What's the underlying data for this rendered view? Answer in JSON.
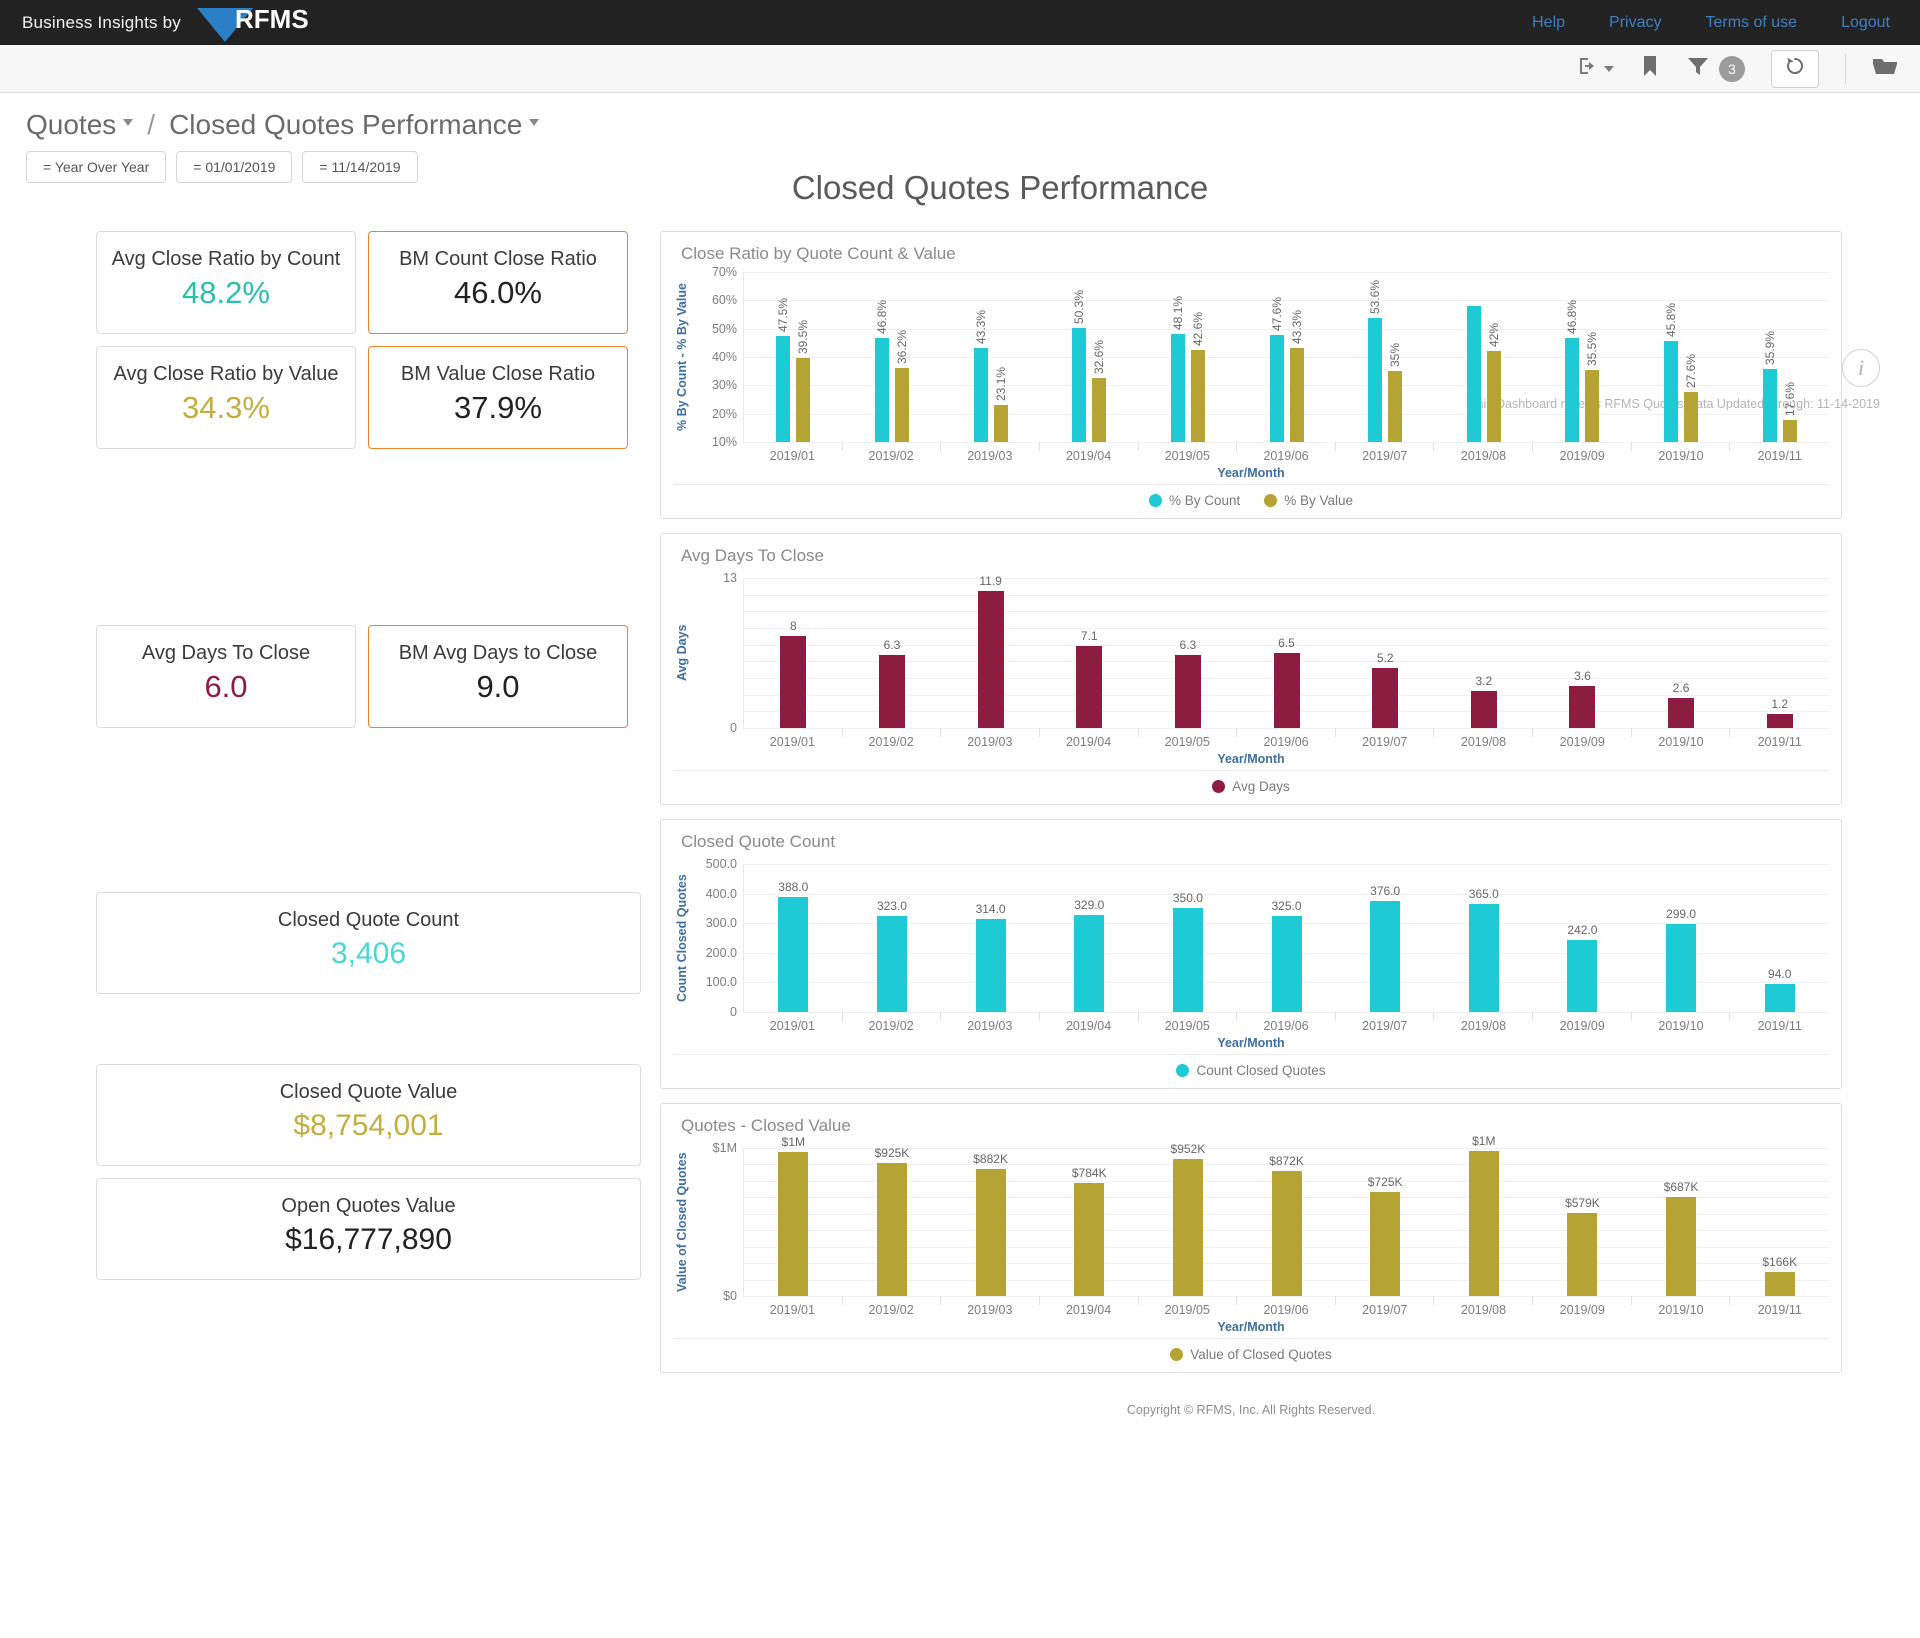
{
  "header": {
    "brand_text": "Business Insights by",
    "brand_logo": "RFMS",
    "nav": [
      {
        "label": "Help"
      },
      {
        "label": "Privacy"
      },
      {
        "label": "Terms of use"
      },
      {
        "label": "Logout"
      }
    ]
  },
  "toolbar": {
    "export_icon": "export-icon",
    "bookmark_icon": "bookmark-icon",
    "filter_icon": "filter-icon",
    "filter_badge": "3",
    "refresh_icon": "refresh-icon",
    "folder_icon": "folder-icon"
  },
  "breadcrumb": {
    "root": "Quotes",
    "separator": "/",
    "current": "Closed Quotes Performance",
    "chips": [
      {
        "label": "= Year Over Year"
      },
      {
        "label": "= 01/01/2019"
      },
      {
        "label": "= 11/14/2019"
      }
    ]
  },
  "page": {
    "title": "Closed Quotes Performance",
    "info_icon": "info-icon",
    "info_note": "This Dashboard reflects RFMS Quotes Data Updated through:  11-14-2019",
    "copyright": "Copyright © RFMS, Inc.  All Rights Reserved."
  },
  "kpis": [
    {
      "label": "Avg Close Ratio by Count",
      "value": "48.2%",
      "color_class": "v-teal",
      "benchmark": false
    },
    {
      "label": "BM Count Close Ratio",
      "value": "46.0%",
      "color_class": "v-dark",
      "benchmark": true
    },
    {
      "label": "Avg Close Ratio by Value",
      "value": "34.3%",
      "color_class": "v-gold",
      "benchmark": false
    },
    {
      "label": "BM Value Close Ratio",
      "value": "37.9%",
      "color_class": "v-dark",
      "benchmark": true
    },
    {
      "label": "Avg Days To Close",
      "value": "6.0",
      "color_class": "v-maroon",
      "benchmark": false
    },
    {
      "label": "BM Avg Days to Close",
      "value": "9.0",
      "color_class": "v-dark",
      "benchmark": true
    },
    {
      "label": "Closed Quote Count",
      "value": "3,406",
      "color_class": "v-cyan",
      "benchmark": false
    },
    {
      "label": "Closed Quote Value",
      "value": "$8,754,001",
      "color_class": "v-gold",
      "benchmark": false
    },
    {
      "label": "Open Quotes Value",
      "value": "$16,777,890",
      "color_class": "v-dark",
      "benchmark": false
    }
  ],
  "colors": {
    "cyan": "#1ecbd4",
    "gold": "#b5a333",
    "maroon": "#8c1d40",
    "accent_orange": "#f0802a",
    "axis_blue": "#3e6f9e"
  },
  "chart_data": [
    {
      "type": "bar",
      "title": "Close Ratio by Quote Count & Value",
      "xlabel": "Year/Month",
      "ylabel": "% By Count - % By Value",
      "categories": [
        "2019/01",
        "2019/02",
        "2019/03",
        "2019/04",
        "2019/05",
        "2019/06",
        "2019/07",
        "2019/08",
        "2019/09",
        "2019/10",
        "2019/11"
      ],
      "yticks": [
        "70%",
        "60%",
        "50%",
        "40%",
        "30%",
        "20%",
        "10%"
      ],
      "ylim": [
        10,
        70
      ],
      "grid": true,
      "legend_position": "bottom",
      "series": [
        {
          "name": "% By Count",
          "color": "#1ecbd4",
          "values": [
            47.5,
            46.8,
            43.3,
            50.3,
            48.1,
            47.6,
            53.6,
            58.0,
            46.8,
            45.8,
            35.9
          ],
          "labels": [
            "47.5%",
            "46.8%",
            "43.3%",
            "50.3%",
            "48.1%",
            "47.6%",
            "53.6%",
            "",
            "46.8%",
            "45.8%",
            "35.9%"
          ]
        },
        {
          "name": "% By Value",
          "color": "#b5a333",
          "values": [
            39.5,
            36.2,
            23.1,
            32.6,
            42.6,
            43.3,
            35.0,
            42.0,
            35.5,
            27.6,
            17.6
          ],
          "labels": [
            "39.5%",
            "36.2%",
            "23.1%",
            "32.6%",
            "42.6%",
            "43.3%",
            "35%",
            "42%",
            "35.5%",
            "27.6%",
            "17.6%"
          ]
        }
      ]
    },
    {
      "type": "bar",
      "title": "Avg Days To Close",
      "xlabel": "Year/Month",
      "ylabel": "Avg Days",
      "categories": [
        "2019/01",
        "2019/02",
        "2019/03",
        "2019/04",
        "2019/05",
        "2019/06",
        "2019/07",
        "2019/08",
        "2019/09",
        "2019/10",
        "2019/11"
      ],
      "yticks": [
        "13",
        "0"
      ],
      "ylim": [
        0,
        13
      ],
      "grid": true,
      "legend_position": "bottom",
      "series": [
        {
          "name": "Avg Days",
          "color": "#8c1d40",
          "values": [
            8,
            6.3,
            11.9,
            7.1,
            6.3,
            6.5,
            5.2,
            3.2,
            3.6,
            2.6,
            1.2
          ],
          "labels": [
            "8",
            "6.3",
            "11.9",
            "7.1",
            "6.3",
            "6.5",
            "5.2",
            "3.2",
            "3.6",
            "2.6",
            "1.2"
          ]
        }
      ]
    },
    {
      "type": "bar",
      "title": "Closed Quote Count",
      "xlabel": "Year/Month",
      "ylabel": "Count Closed Quotes",
      "categories": [
        "2019/01",
        "2019/02",
        "2019/03",
        "2019/04",
        "2019/05",
        "2019/06",
        "2019/07",
        "2019/08",
        "2019/09",
        "2019/10",
        "2019/11"
      ],
      "yticks": [
        "500.0",
        "400.0",
        "300.0",
        "200.0",
        "100.0",
        "0"
      ],
      "ylim": [
        0,
        500
      ],
      "grid": true,
      "legend_position": "bottom",
      "series": [
        {
          "name": "Count Closed Quotes",
          "color": "#1ecbd4",
          "values": [
            388,
            323,
            314,
            329,
            350,
            325,
            376,
            365,
            242,
            299,
            94
          ],
          "labels": [
            "388.0",
            "323.0",
            "314.0",
            "329.0",
            "350.0",
            "325.0",
            "376.0",
            "365.0",
            "242.0",
            "299.0",
            "94.0"
          ]
        }
      ]
    },
    {
      "type": "bar",
      "title": "Quotes - Closed Value",
      "xlabel": "Year/Month",
      "ylabel": "Value of Closed Quotes",
      "categories": [
        "2019/01",
        "2019/02",
        "2019/03",
        "2019/04",
        "2019/05",
        "2019/06",
        "2019/07",
        "2019/08",
        "2019/09",
        "2019/10",
        "2019/11"
      ],
      "yticks": [
        "$1M",
        "$0"
      ],
      "ylim": [
        0,
        1030000
      ],
      "grid": true,
      "legend_position": "bottom",
      "series": [
        {
          "name": "Value of Closed Quotes",
          "color": "#b5a333",
          "values": [
            1000000,
            925000,
            882000,
            784000,
            952000,
            872000,
            725000,
            1010000,
            579000,
            687000,
            166000
          ],
          "labels": [
            "$1M",
            "$925K",
            "$882K",
            "$784K",
            "$952K",
            "$872K",
            "$725K",
            "$1M",
            "$579K",
            "$687K",
            "$166K"
          ]
        }
      ]
    }
  ]
}
